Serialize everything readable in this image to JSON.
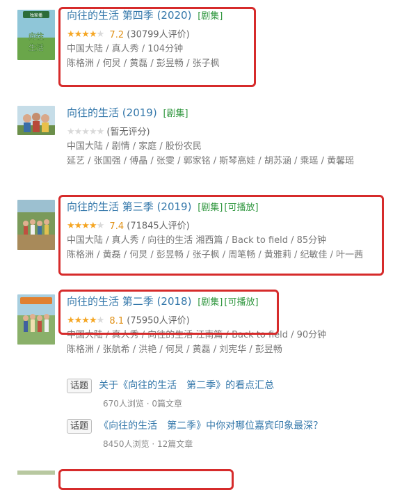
{
  "items": [
    {
      "title": "向往的生活 第四季",
      "year": "(2020)",
      "tags": [
        "[剧集]"
      ],
      "stars": [
        1,
        1,
        1,
        0.5,
        0
      ],
      "score": "7.2",
      "count": "(30799人评价)",
      "meta1": "中国大陆 / 真人秀 / 104分钟",
      "meta2": "陈格洲 / 何炅 / 黄磊 / 彭昱畅 / 张子枫",
      "poster_text": "向往的生活",
      "poster_badge": "独家播"
    },
    {
      "title": "向往的生活",
      "year": "(2019)",
      "tags": [
        "[剧集]"
      ],
      "stars": [
        0,
        0,
        0,
        0,
        0
      ],
      "score": "",
      "count": "(暂无评分)",
      "meta1": "中国大陆 / 剧情 / 家庭 / 股份农民",
      "meta2": "延艺 / 张国强 / 傅晶 / 张雯 / 郭家铭 / 斯琴高娃 / 胡苏涵 / 乘瑶 / 黄馨瑶"
    },
    {
      "title": "向往的生活 第三季",
      "year": "(2019)",
      "tags": [
        "[剧集]",
        "[可播放]"
      ],
      "stars": [
        1,
        1,
        1,
        0.5,
        0
      ],
      "score": "7.4",
      "count": "(71845人评价)",
      "meta1": "中国大陆 / 真人秀 / 向往的生活 湘西篇 / Back to field / 85分钟",
      "meta2": "陈格洲 / 黄磊 / 何炅 / 彭昱畅 / 张子枫 / 周笔畅 / 黄雅莉 / 纪敏佳 / 叶一茜"
    },
    {
      "title": "向往的生活 第二季",
      "year": "(2018)",
      "tags": [
        "[剧集]",
        "[可播放]"
      ],
      "stars": [
        1,
        1,
        1,
        1,
        0
      ],
      "score": "8.1",
      "count": "(75950人评价)",
      "meta1": "中国大陆 / 真人秀 / 向往的生活 江南篇 / Back to field / 90分钟",
      "meta2": "陈格洲 / 张航希 / 洪艳 / 何炅 / 黄磊 / 刘宪华 / 彭昱畅"
    }
  ],
  "topics": [
    {
      "badge": "话题",
      "title": "关于《向往的生活　第二季》的看点汇总",
      "meta": "670人浏览 · 0篇文章"
    },
    {
      "badge": "话题",
      "title": "《向往的生活　第二季》中你对哪位嘉宾印象最深？",
      "meta": "8450人浏览 · 12篇文章"
    }
  ],
  "colors": {
    "highlight": "#d62b2b",
    "link": "#3377aa",
    "tag": "#2e963d",
    "star": "#f5a623"
  }
}
